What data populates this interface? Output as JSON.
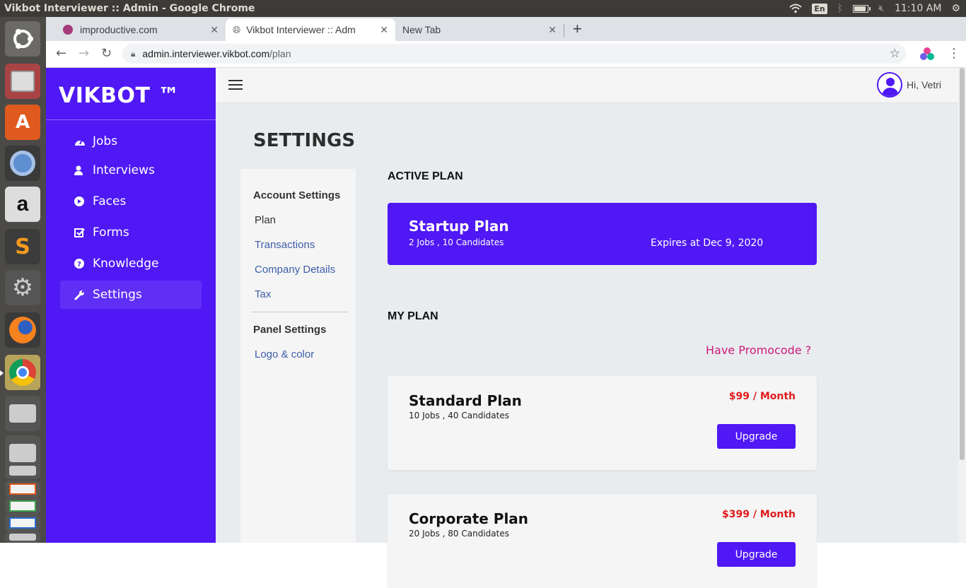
{
  "os": {
    "window_title": "Vikbot Interviewer :: Admin - Google Chrome",
    "lang": "En",
    "time": "11:10 AM",
    "battery_level": 0.8
  },
  "launcher": {
    "apps": [
      "ubuntu-dash",
      "files",
      "software-center",
      "chromium",
      "amazon",
      "sublime-text",
      "system-settings",
      "firefox",
      "chrome",
      "drive",
      "drive",
      "drive",
      "spreadsheet",
      "presentation",
      "document",
      "drive"
    ]
  },
  "browser": {
    "tabs": [
      {
        "title": "improductive.com",
        "close": "✕"
      },
      {
        "title": "Vikbot Interviewer :: Adm",
        "close": "✕"
      },
      {
        "title": "New Tab",
        "close": "✕"
      }
    ],
    "new_tab": "+",
    "url_host": "admin.interviewer.vikbot.com",
    "url_path": "/plan"
  },
  "sidebar": {
    "brand": "VIKBOT ™",
    "items": [
      {
        "label": "Jobs",
        "icon": "dashboard-icon"
      },
      {
        "label": "Interviews",
        "icon": "user-icon"
      },
      {
        "label": "Faces",
        "icon": "play-icon"
      },
      {
        "label": "Forms",
        "icon": "checkbox-icon"
      },
      {
        "label": "Knowledge",
        "icon": "question-icon"
      },
      {
        "label": "Settings",
        "icon": "wrench-icon"
      }
    ]
  },
  "header": {
    "greeting": "Hi, Vetri"
  },
  "page": {
    "title": "SETTINGS"
  },
  "settings_nav": {
    "account_heading": "Account Settings",
    "account_links": [
      "Plan",
      "Transactions",
      "Company Details",
      "Tax"
    ],
    "panel_heading": "Panel Settings",
    "panel_links": [
      "Logo & color"
    ]
  },
  "active_plan": {
    "label": "ACTIVE PLAN",
    "name": "Startup Plan",
    "details": "2 Jobs , 10 Candidates",
    "expires": "Expires at Dec 9, 2020"
  },
  "my_plan": {
    "label": "MY PLAN",
    "promo": "Have Promocode ?",
    "plans": [
      {
        "name": "Standard Plan",
        "details": "10 Jobs , 40 Candidates",
        "price": "$99 / Month",
        "button": "Upgrade"
      },
      {
        "name": "Corporate Plan",
        "details": "20 Jobs , 80 Candidates",
        "price": "$399 / Month",
        "button": "Upgrade"
      }
    ]
  },
  "colors": {
    "brand": "#4f18f5",
    "price": "#e01b1b",
    "promo": "#cc1a7a",
    "link": "#3d5ea8"
  }
}
